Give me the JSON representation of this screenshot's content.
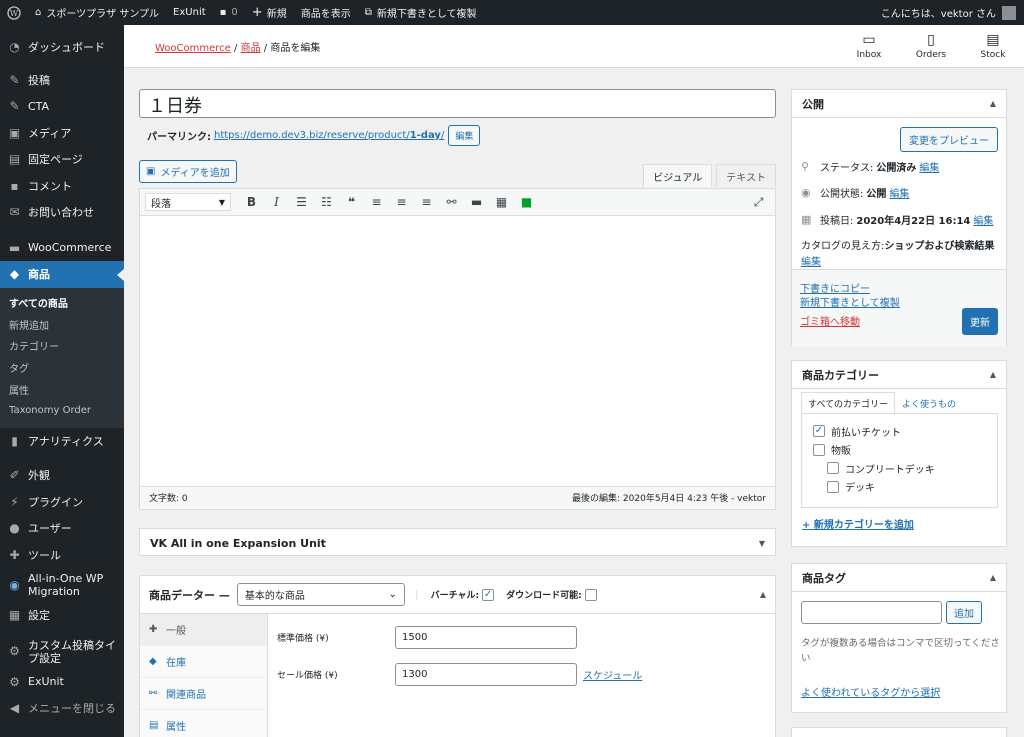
{
  "adminbar": {
    "site_name": "スポーツプラザ サンプル",
    "exunit": "ExUnit",
    "comments_count": "0",
    "new": "新規",
    "view_product": "商品を表示",
    "duplicate_draft": "新規下書きとして複製",
    "greeting": "こんにちは、vektor さん"
  },
  "sidebar": {
    "items": [
      {
        "label": "ダッシュボード",
        "icon": "dashboard-icon"
      },
      {
        "label": "投稿",
        "icon": "pin-icon"
      },
      {
        "label": "CTA",
        "icon": "pin-icon"
      },
      {
        "label": "メディア",
        "icon": "media-icon"
      },
      {
        "label": "固定ページ",
        "icon": "page-icon"
      },
      {
        "label": "コメント",
        "icon": "comment-icon"
      },
      {
        "label": "お問い合わせ",
        "icon": "mail-icon"
      },
      {
        "label": "WooCommerce",
        "icon": "woo-icon"
      },
      {
        "label": "商品",
        "icon": "box-icon"
      }
    ],
    "submenu": [
      "すべての商品",
      "新規追加",
      "カテゴリー",
      "タグ",
      "属性",
      "Taxonomy Order"
    ],
    "items2": [
      {
        "label": "アナリティクス",
        "icon": "chart-icon"
      },
      {
        "label": "外観",
        "icon": "brush-icon"
      },
      {
        "label": "プラグイン",
        "icon": "plugin-icon"
      },
      {
        "label": "ユーザー",
        "icon": "user-icon"
      },
      {
        "label": "ツール",
        "icon": "wrench-icon"
      },
      {
        "label": "All-in-One WP Migration",
        "icon": "migration-icon"
      },
      {
        "label": "設定",
        "icon": "settings-icon"
      },
      {
        "label": "カスタム投稿タイプ設定",
        "icon": "gear-icon"
      },
      {
        "label": "ExUnit",
        "icon": "gear-icon"
      },
      {
        "label": "メニューを閉じる",
        "icon": "collapse-icon"
      }
    ]
  },
  "breadcrumb": {
    "woocommerce": "WooCommerce",
    "products": "商品",
    "current": "商品を編集",
    "sep": "/"
  },
  "toolbar_buttons": {
    "inbox": "Inbox",
    "orders": "Orders",
    "stock": "Stock"
  },
  "post": {
    "title": "１日券",
    "permalink_label": "パーマリンク:",
    "permalink_base": "https://demo.dev3.biz/reserve/product/",
    "permalink_slug": "1-day",
    "permalink_trail": "/",
    "edit": "編集"
  },
  "editor": {
    "add_media": "メディアを追加",
    "tab_visual": "ビジュアル",
    "tab_text": "テキスト",
    "format": "段落",
    "word_count": "文字数: 0",
    "last_edit": "最後の編集: 2020年5月4日 4:23 午後 - vektor"
  },
  "vk_box": {
    "title": "VK All in one Expansion Unit"
  },
  "product_data": {
    "title": "商品データー —",
    "type": "基本的な商品",
    "virtual": "バーチャル:",
    "downloadable": "ダウンロード可能:",
    "tabs": [
      {
        "label": "一般",
        "icon": "wrench-icon"
      },
      {
        "label": "在庫",
        "icon": "tag-icon"
      },
      {
        "label": "関連商品",
        "icon": "link-icon"
      },
      {
        "label": "属性",
        "icon": "list-icon"
      }
    ],
    "regular_price_label": "標準価格 (¥)",
    "regular_price": "1500",
    "sale_price_label": "セール価格 (¥)",
    "sale_price": "1300",
    "schedule": "スケジュール"
  },
  "publish": {
    "title": "公開",
    "preview": "変更をプレビュー",
    "status_label": "ステータス:",
    "status": "公開済み",
    "visibility_label": "公開状態:",
    "visibility": "公開",
    "date_label": "投稿日:",
    "date": "2020年4月22日 16:14",
    "catalog_label": "カタログの見え方:",
    "catalog": "ショップおよび検索結果",
    "edit": "編集",
    "copy_draft": "下書きにコピー",
    "new_draft": "新規下書きとして複製",
    "trash": "ゴミ箱へ移動",
    "update": "更新"
  },
  "categories": {
    "title": "商品カテゴリー",
    "tab_all": "すべてのカテゴリー",
    "tab_popular": "よく使うもの",
    "items": [
      {
        "label": "前払いチケット",
        "checked": "✓"
      },
      {
        "label": "物販",
        "checked": ""
      },
      {
        "label": "コンプリートデッキ",
        "checked": ""
      },
      {
        "label": "デッキ",
        "checked": ""
      }
    ],
    "add_new": "+ 新規カテゴリーを追加"
  },
  "tags": {
    "title": "商品タグ",
    "add": "追加",
    "help": "タグが複数ある場合はコンマで区切ってください",
    "popular": "よく使われているタグから選択"
  },
  "colors": {
    "accent": "#2271b1",
    "admin_dark": "#1d2327",
    "danger": "#d63638"
  }
}
